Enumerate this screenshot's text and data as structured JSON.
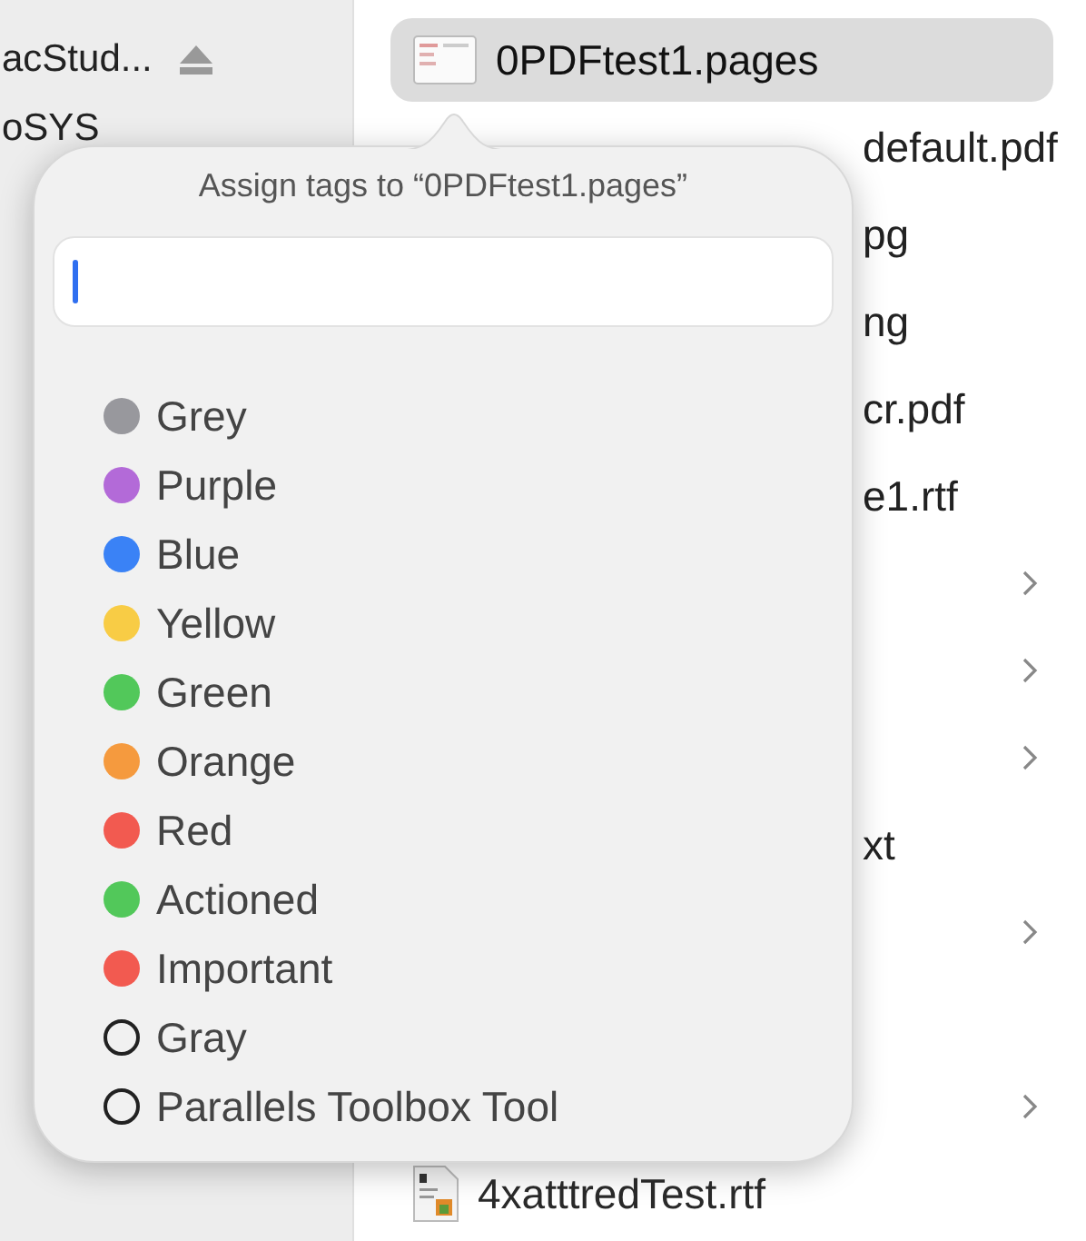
{
  "sidebar": {
    "items": [
      {
        "label": "acStud...",
        "kind": "volume"
      },
      {
        "label": "oSYS",
        "kind": "plain"
      }
    ]
  },
  "files": [
    {
      "kind": "file",
      "name": "0PDFtest1.pages",
      "selected": true
    },
    {
      "kind": "fragment",
      "name": "default.pdf",
      "selected": false
    },
    {
      "kind": "fragment",
      "name": "pg",
      "selected": false
    },
    {
      "kind": "fragment",
      "name": "ng",
      "selected": false
    },
    {
      "kind": "fragment",
      "name": "cr.pdf",
      "selected": false
    },
    {
      "kind": "fragment",
      "name": "e1.rtf",
      "selected": false
    },
    {
      "kind": "folder",
      "selected": false
    },
    {
      "kind": "folder",
      "selected": false
    },
    {
      "kind": "folder",
      "selected": false
    },
    {
      "kind": "fragment",
      "name": "xt",
      "selected": false
    },
    {
      "kind": "folder",
      "selected": false
    },
    {
      "kind": "empty",
      "selected": false
    },
    {
      "kind": "folder",
      "selected": false
    },
    {
      "kind": "file",
      "name": "4xatttredTest.rtf",
      "selected": false
    }
  ],
  "popover": {
    "title": "Assign tags to “0PDFtest1.pages”",
    "tags": [
      {
        "label": "Grey",
        "kind": "filled",
        "color": "#98989d"
      },
      {
        "label": "Purple",
        "kind": "filled",
        "color": "#b36ad8"
      },
      {
        "label": "Blue",
        "kind": "filled",
        "color": "#3a82f6"
      },
      {
        "label": "Yellow",
        "kind": "filled",
        "color": "#f8cc45"
      },
      {
        "label": "Green",
        "kind": "filled",
        "color": "#52c85a"
      },
      {
        "label": "Orange",
        "kind": "filled",
        "color": "#f59a3e"
      },
      {
        "label": "Red",
        "kind": "filled",
        "color": "#f25a50"
      },
      {
        "label": "Actioned",
        "kind": "filled",
        "color": "#52c85a"
      },
      {
        "label": "Important",
        "kind": "filled",
        "color": "#f25a50"
      },
      {
        "label": "Gray",
        "kind": "outline"
      },
      {
        "label": "Parallels Toolbox Tool",
        "kind": "outline"
      }
    ]
  }
}
